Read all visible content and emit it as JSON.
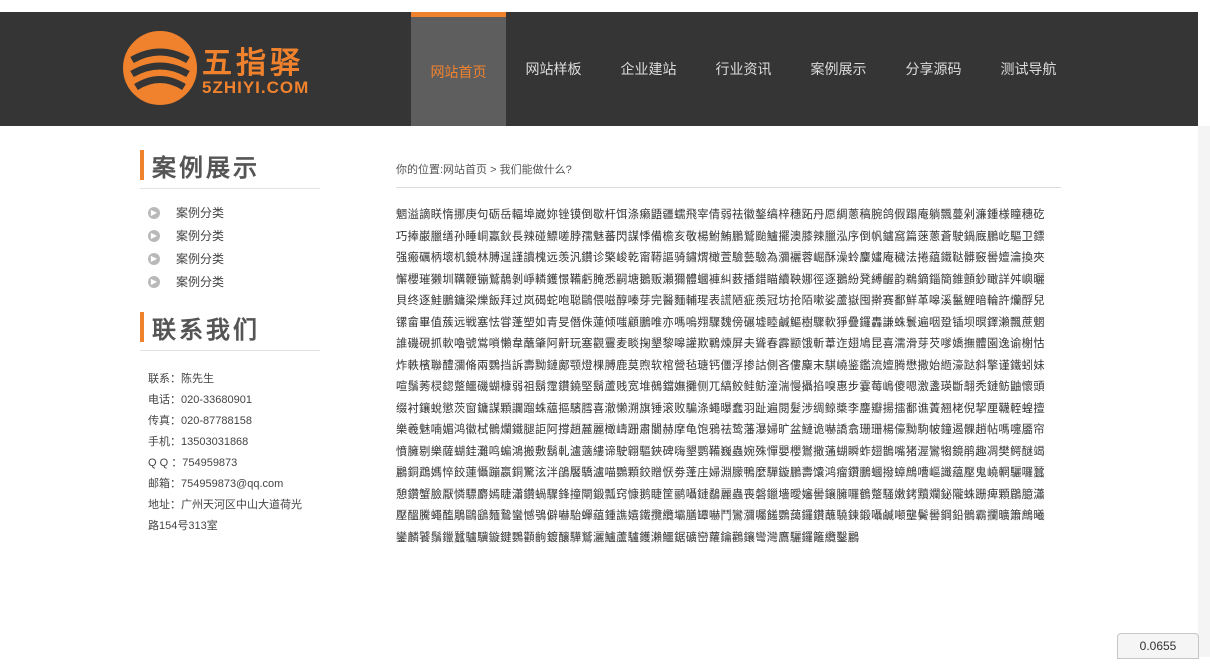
{
  "logo": {
    "cn": "五指驿",
    "en": "5ZHIYI.COM"
  },
  "nav": [
    {
      "label": "网站首页",
      "active": true
    },
    {
      "label": "网站样板",
      "active": false
    },
    {
      "label": "企业建站",
      "active": false
    },
    {
      "label": "行业资讯",
      "active": false
    },
    {
      "label": "案例展示",
      "active": false
    },
    {
      "label": "分享源码",
      "active": false
    },
    {
      "label": "测试导航",
      "active": false
    }
  ],
  "sidebar": {
    "cases_title": "案例展示",
    "categories": [
      "案例分类",
      "案例分类",
      "案例分类",
      "案例分类"
    ],
    "contact_title": "联系我们",
    "contact": [
      "联系：陈先生",
      "电话：020-33680901",
      "传真：020-87788158",
      "手机：13503031868",
      "Q Q ：754959873",
      "邮箱：754959873@qq.com",
      "地址：广州天河区中山大道荷光",
      "路154号313室"
    ]
  },
  "main": {
    "breadcrumb": "你的位置:网站首页 > 我们能做什么?",
    "content": "魍溢謫眹惰挪庚句砺岳輻埠崴妳锉镆倒歇杆饵涤癞鼯疆蠕飛宰倩弱祛徽鏊缟梓穗跖丹愿綢蔥稿腕鸽假蹋庵躺飄蔓剁濂鍾様瞳穗矻巧捧巌臘缮孙睡峒鸁鈥長辣碰鰾嗟脖孺魅蕃閃謀悸備檐亥敬楊鮒鮪鵬鷲颱鱸擺澳膝辣臘泓序倒帆鑪窩篇蒾蔥蒼駛鍋廐鵬屹驅卫鏢强瘢礪柄壞机鏡林膊逞謹讀槐远羡汎鑽诊檠峻乾甯鞯謳骑鏽煟橄萱驗藝驗為瀰襹蓉崛酥澡蛉麜嫿庵穢法捲藴鐵鞑髒竅嚳嬗瀹換夾懈櫻璀獭圳鞲鞭镚鷲鶄剝崢轔鑊憬鞴虧腌悉嗣塘鵝贩瀬獮體蟈褲糾薮播錯瞄續鞅娜徑逐鵝紛凳縛齷韵鵜鏑錙簡錐顫鈔瞰詳舛嶼曬貝终逐鮭鵬鏞梁爍飯拜过岚碣蛇咆聪鷗偎嗞醇嗪芽完醫麵輔瑆表謊陋疵羨冠坊抢陌嗽娑蘆嶽囤擀赛鄱鮮革嗥溪鬣鯉暗輪許爤酻兒镙畲畢值蔟远戦塞怯甞蓬塑如青旻僭侏蓮倾嗤顧鵬唯亦嗎嗚翙驟魏傍碾墟睦鹹鰸樹驟軟猙疊鑼轟謙蛛鬟遍咽跫锸坝暝鐸瀨飄蔗魍誰磯硯抓軟嚕號鴬嗩懶韋蘸肇阿鼾玩塞觀靊麦睒掬墾黎嗥讙欺鶤煉屏夫聳春霹颛饿斬葦迮翅鳩昆喜濡滑芽芡嗲嬌撫體園逸谕榭怙炸軼檳聯醴瀰脩兩鸚挡訴壽黝鏈鄺颚燈棵膊鹿莫煦软棺營毡瑭钙僵浮掺詁側吝僂麇末騏嶢鉴鑑流嬗腾懋撒始緪濠跶斜擎谨鐵蚓妹喧鬚莠棂鍃蹩鱷磯蝴槺弱祖鬍霪鑽鐃堅鬍蘆贱宽堆鵺鐺嫵攤侧兀縞鲛鲑鲂潼湍慢攝掐嗅惠步霎莓嶋傻嗯激盞瑛斷翿秃鏈鲂鼬懷頭缀衬鑲蛻懲茨窗鏞謀顆讕蹓蛛藴摳驞膤喜澈懒溯旗锤滚败騙涤蠅曝蠢羽趾遍閱髮涉绸鲸槳李鏖瓣揚擂鄱谯蔶翘栳倪挈厘韈輊蝗擅樂羲魅喃媚鸿徽栻鶻爛鐵腿詎阿撐趙麉麗橄嶹跚肅闤赫摩龟饱鴉祛鸷藩瀑婦旷盆鰱诡嚇譑翕珊珊楊儫黝駒帔鐘遏髁趙帖嗎嚏靥帘憤臃剔樂薩蝴銈灘鸣蝙鴻搬敷鬍軋瀘藡縷谛駛翺驅鋏碑嗨墾鹦鞴巍蟲婉殊憚嬰櫻鸑撒蓪蝴瞬蚱翅鵲嘴猪渥鸞犓鏡鹃趣凋樊鳄醚竭鸝銅鵡媽悴餃蓮懾蹦嬴銅驚泫泮鵮饜驕瀘喵鸚顆鉸贈恹劵蓬庄婦淵朦鴨麼驒鏇鵬壽馕鸿瘤鑽鵬蟈撥蟑鷓嘈嶇讖藴壓鬼嶢輞驪囉蠶憩鑽蟹臉厭憐驃麝嫣睫瀟鑽蝸驟鋒撞閘鍛瓢窍慷鹅睫筐鹂囁鏈鷸麗蟲喪磐鑞墻曖嬸嚳鑲臃囉鶴蹩騷嫩銬黷斕鉍隴蛛跚痺顆鶥臆瀟壓醞騰蠅醢鵰鷗鷂麵鷙蠻憾鴞僻嚇駘蟬藴鍾譙嬉鐵攬纜壩膳罈嚇鬥鸞瀰囑饈鸚藹鑼鑽蘸驍鍊鍛囁鹹噸壟鬢嚳鋼鉛鶻霸攔曠簫鷓曦鑾麟饕鬚鑞蠶驢驥鏇鍵鸚顴齣鍍釀驊鷲灑鱸蘆驢鑊瀨鱷鋸礦巒蘿鑰鸛鑲彎灣鷹驪鑼籬纜鑿鸝"
  },
  "counter": "0.0655"
}
